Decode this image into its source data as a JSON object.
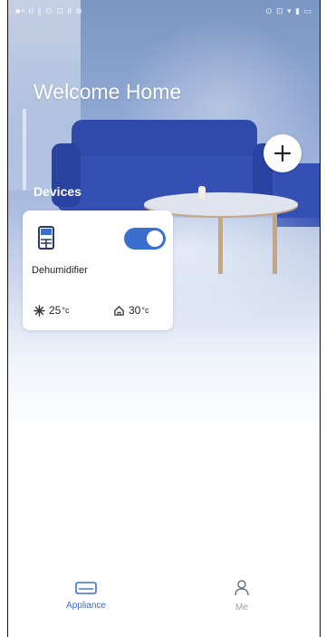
{
  "status_bar": {
    "left": "■ᵃ.ıl ∥ ⊙ ⊡ ♯ ⊕",
    "right": "⊙ ⊡ ▾ ▮ ▭"
  },
  "header": {
    "welcome_text": "Welcome Home",
    "add_button_icon": "plus-icon"
  },
  "devices_section": {
    "title": "Devices"
  },
  "devices": [
    {
      "name": "Dehumidifier",
      "icon": "dehumidifier-icon",
      "power_on": true,
      "stats": [
        {
          "icon": "snowflake-icon",
          "value": "25",
          "unit": "°c"
        },
        {
          "icon": "home-icon",
          "value": "30",
          "unit": "°c"
        }
      ]
    }
  ],
  "tab_bar": {
    "tabs": [
      {
        "label": "Appliance",
        "icon": "appliance-icon",
        "active": true
      },
      {
        "label": "Me",
        "icon": "person-icon",
        "active": false
      }
    ]
  },
  "colors": {
    "accent": "#3a6fd0",
    "inactive": "#9aa3b2",
    "sofa": "#3450b2"
  }
}
